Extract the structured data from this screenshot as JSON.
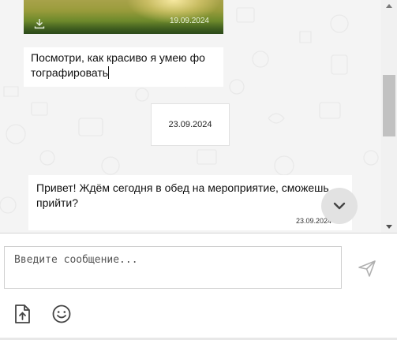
{
  "chat": {
    "photo_message": {
      "date": "19.09.2024",
      "icon": "download-icon"
    },
    "message_1": {
      "text": "Посмотри, как красиво я умею фо тографировать"
    },
    "date_separator": "23.09.2024",
    "message_2": {
      "text": "Привет! Ждём сегодня в обед на мероприятие, сможешь прийти?",
      "time": "23.09.2024"
    },
    "scroll_down_icon": "chevron-down-icon"
  },
  "composer": {
    "placeholder": "Введите сообщение...",
    "send_icon": "send-icon",
    "attach_icon": "attach-file-icon",
    "emoji_icon": "smiley-icon"
  },
  "colors": {
    "background": "#f4f4f4",
    "bubble": "#ffffff",
    "scroll_button": "#e2e2e2"
  }
}
